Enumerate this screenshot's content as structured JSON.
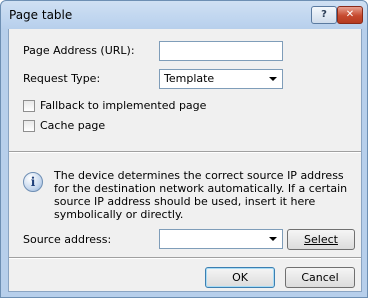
{
  "window": {
    "title": "Page table",
    "help_glyph": "?",
    "close_glyph": "✕"
  },
  "form": {
    "page_address_label": "Page Address (URL):",
    "page_address_value": "",
    "request_type_label": "Request Type:",
    "request_type_value": "Template",
    "fallback_label": "Fallback to implemented page",
    "fallback_checked": false,
    "cache_label": "Cache page",
    "cache_checked": false
  },
  "info": {
    "icon": "info-icon",
    "text": "The device determines the correct source IP address for the destination network automatically. If a certain source IP address should be used, insert it here symbolically or directly."
  },
  "source": {
    "label": "Source address:",
    "value": "",
    "select_button": "Select"
  },
  "buttons": {
    "ok": "OK",
    "cancel": "Cancel"
  }
}
